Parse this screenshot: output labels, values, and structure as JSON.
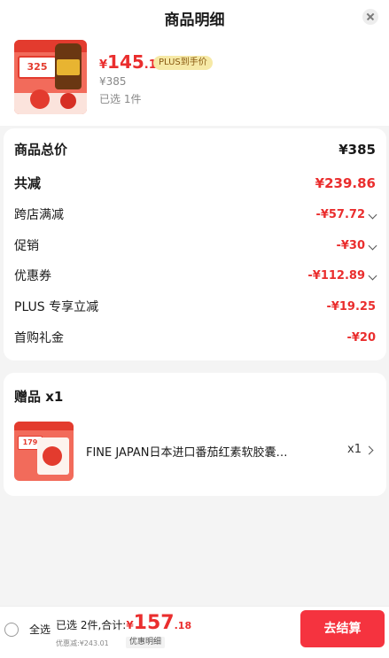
{
  "header": {
    "title": "商品明细"
  },
  "product": {
    "thumb_badge": "325",
    "price_symbol": "¥",
    "price_int": "145",
    "price_dec": ".14",
    "plus_tag": "PLUS到手价",
    "original_price": "¥385",
    "selected_count": "已选 1件"
  },
  "summary": {
    "rows": [
      {
        "label": "商品总价",
        "value": "¥385"
      },
      {
        "label": "共减",
        "value": "¥239.86"
      },
      {
        "label": "跨店满减",
        "value": "-¥57.72"
      },
      {
        "label": "促销",
        "value": "-¥30"
      },
      {
        "label": "优惠券",
        "value": "-¥112.89"
      },
      {
        "label": "PLUS 专享立减",
        "value": "-¥19.25"
      },
      {
        "label": "首购礼金",
        "value": "-¥20"
      }
    ]
  },
  "gift": {
    "title": "赠品 x1",
    "thumb_badge": "179",
    "name": "FINE JAPAN日本进口番茄红素软胶囊…",
    "quantity": "x1"
  },
  "footer": {
    "select_all": "全选",
    "summary_text": "已选 2件,合计:",
    "total_symbol": "¥",
    "total_int": "157",
    "total_dec": ".18",
    "discount_line": "优惠减:¥243.01",
    "discount_link": "优惠明细",
    "checkout": "去结算"
  },
  "colors": {
    "accent_red": "#ea2e2e",
    "checkout_red": "#f5333f",
    "plus_tag_bg": "#f6e9a6",
    "page_bg": "#f4f4f4"
  },
  "icons": {
    "close": "close-icon",
    "chevron_down": "chevron-down-icon",
    "chevron_right": "chevron-right-icon"
  }
}
